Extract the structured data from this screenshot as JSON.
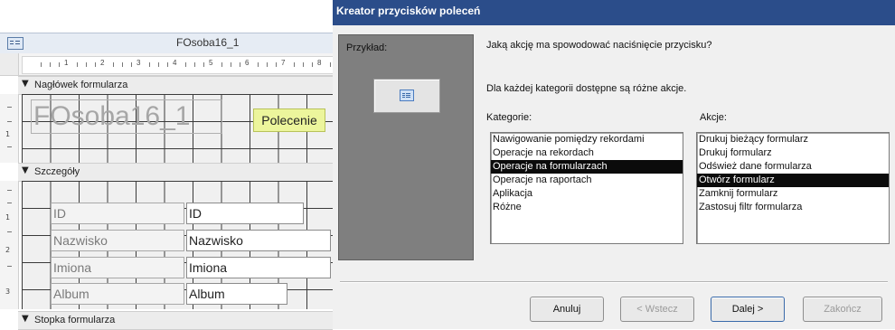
{
  "designer": {
    "title": "FOsoba16_1",
    "ruler_numbers": [
      "1",
      "2",
      "3",
      "4",
      "5",
      "6",
      "7",
      "8"
    ],
    "vruler_header": [
      "1"
    ],
    "vruler_detail": [
      "1",
      "2",
      "3"
    ],
    "sections": {
      "header": "Nagłówek formularza",
      "detail": "Szczegóły",
      "footer": "Stopka formularza"
    },
    "header_title": "FOsoba16_1",
    "command_button": "Polecenie",
    "fields": [
      {
        "label": "ID",
        "control": "ID"
      },
      {
        "label": "Nazwisko",
        "control": "Nazwisko"
      },
      {
        "label": "Imiona",
        "control": "Imiona"
      },
      {
        "label": "Album",
        "control": "Album"
      }
    ]
  },
  "wizard": {
    "title": "Kreator przycisków poleceń",
    "preview_label": "Przykład:",
    "question": "Jaką akcję ma spowodować naciśnięcie przycisku?",
    "info": "Dla każdej kategorii dostępne są różne akcje.",
    "categories_label": "Kategorie:",
    "actions_label": "Akcje:",
    "categories": [
      "Nawigowanie pomiędzy rekordami",
      "Operacje na rekordach",
      "Operacje na formularzach",
      "Operacje na raportach",
      "Aplikacja",
      "Różne"
    ],
    "selected_category": "Operacje na formularzach",
    "actions": [
      "Drukuj bieżący formularz",
      "Drukuj formularz",
      "Odśwież dane formularza",
      "Otwórz formularz",
      "Zamknij formularz",
      "Zastosuj filtr formularza"
    ],
    "selected_action": "Otwórz formularz",
    "buttons": {
      "cancel": "Anuluj",
      "back": "< Wstecz",
      "next": "Dalej >",
      "finish": "Zakończ"
    }
  }
}
